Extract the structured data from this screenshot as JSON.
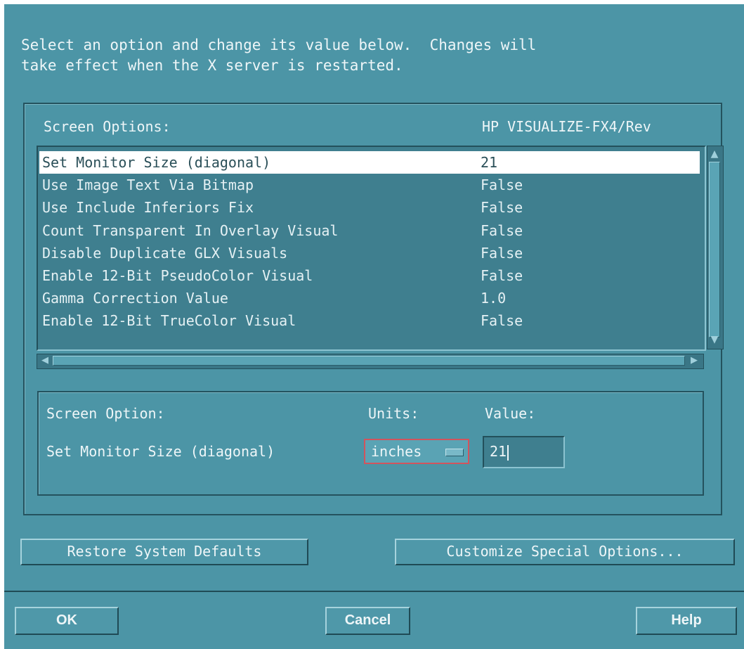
{
  "instructions": {
    "line1": "Select an option and change its value below.  Changes will",
    "line2": "take effect when the X server is restarted."
  },
  "screen_options": {
    "header_label": "Screen Options:",
    "device_label": "HP VISUALIZE-FX4/Rev",
    "items": [
      {
        "option": "Set Monitor Size (diagonal)",
        "value": "21",
        "selected": true
      },
      {
        "option": "Use Image Text Via Bitmap",
        "value": "False"
      },
      {
        "option": "Use Include Inferiors Fix",
        "value": "False"
      },
      {
        "option": "Count Transparent In Overlay Visual",
        "value": "False"
      },
      {
        "option": "Disable Duplicate GLX Visuals",
        "value": "False"
      },
      {
        "option": "Enable 12-Bit PseudoColor Visual",
        "value": "False"
      },
      {
        "option": "Gamma Correction Value",
        "value": "1.0"
      },
      {
        "option": "Enable 12-Bit TrueColor Visual",
        "value": "False"
      }
    ]
  },
  "editor": {
    "option_header": "Screen Option:",
    "units_header": "Units:",
    "value_header": "Value:",
    "current_option": "Set Monitor Size (diagonal)",
    "units_selected": "inches",
    "value": "21"
  },
  "buttons": {
    "restore_defaults": "Restore System Defaults",
    "customize_special": "Customize Special Options...",
    "ok": "OK",
    "cancel": "Cancel",
    "help": "Help"
  },
  "icons": {
    "scroll_up": "arrow-up-icon",
    "scroll_down": "arrow-down-icon",
    "scroll_left": "arrow-left-icon",
    "scroll_right": "arrow-right-icon"
  },
  "colors": {
    "background": "#4c95a6",
    "list_background": "#3f7f8f",
    "selection": "#ffffff",
    "units_focus_border": "#d2545d"
  }
}
